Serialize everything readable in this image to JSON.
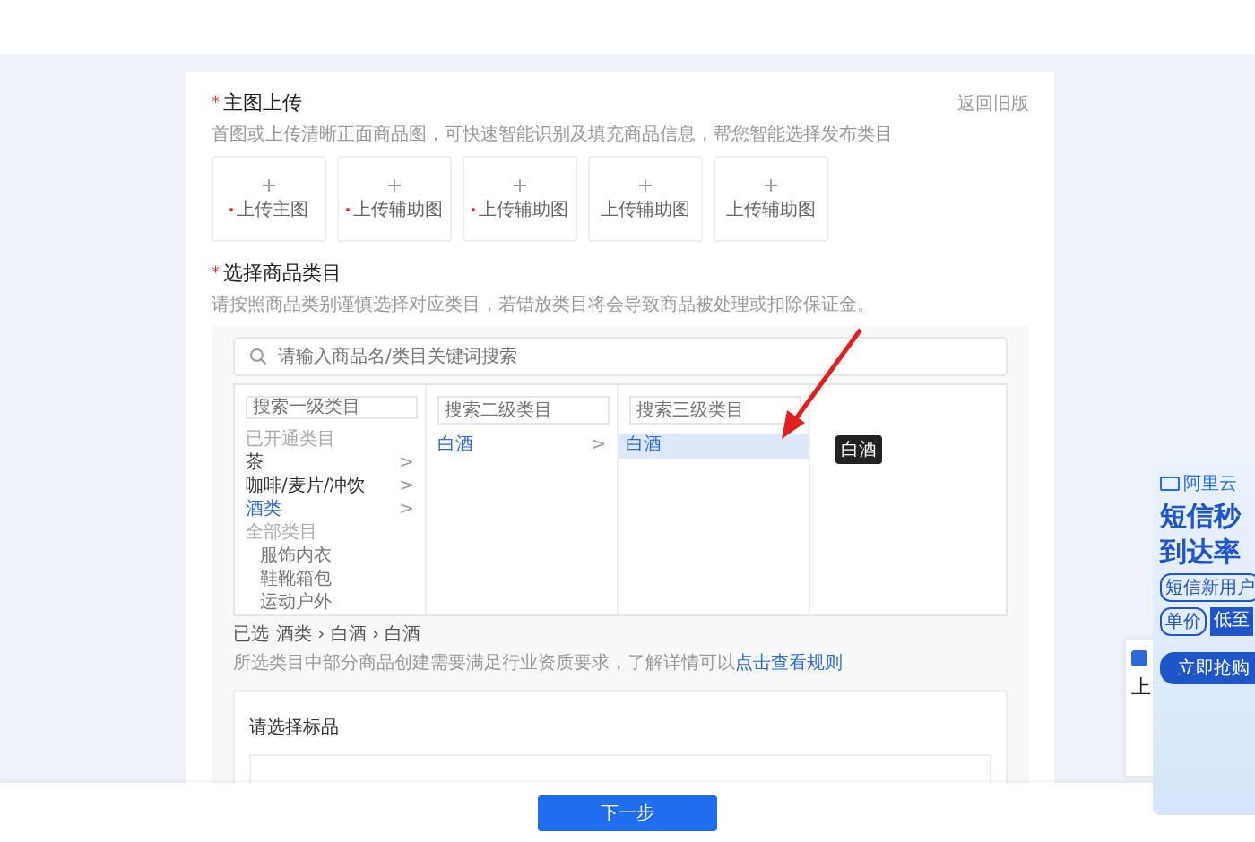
{
  "main_image": {
    "required_mark": "*",
    "title": "主图上传",
    "hint": "首图或上传清晰正面商品图，可快速智能识别及填充商品信息，帮您智能选择发布类目",
    "back_link": "返回旧版",
    "tiles": [
      {
        "plus": "+",
        "label": "上传主图",
        "required": true
      },
      {
        "plus": "+",
        "label": "上传辅助图",
        "required": true
      },
      {
        "plus": "+",
        "label": "上传辅助图",
        "required": true
      },
      {
        "plus": "+",
        "label": "上传辅助图",
        "required": false
      },
      {
        "plus": "+",
        "label": "上传辅助图",
        "required": false
      }
    ]
  },
  "category": {
    "required_mark": "*",
    "title": "选择商品类目",
    "hint": "请按照商品类别谨慎选择对应类目，若错放类目将会导致商品被处理或扣除保证金。",
    "search": {
      "placeholder": "请输入商品名/类目关键词搜索"
    },
    "columns": [
      {
        "placeholder": "搜索一级类目",
        "items": [
          {
            "kind": "group",
            "label": "已开通类目"
          },
          {
            "kind": "item",
            "label": "茶",
            "arrow": ">",
            "selected": false
          },
          {
            "kind": "item",
            "label": "咖啡/麦片/冲饮",
            "arrow": ">",
            "selected": false
          },
          {
            "kind": "item",
            "label": "酒类",
            "arrow": ">",
            "selected": true
          },
          {
            "kind": "group",
            "label": "全部类目"
          },
          {
            "kind": "folded",
            "label": "服饰内衣"
          },
          {
            "kind": "folded",
            "label": "鞋靴箱包"
          },
          {
            "kind": "folded",
            "label": "运动户外"
          }
        ]
      },
      {
        "placeholder": "搜索二级类目",
        "items": [
          {
            "kind": "item",
            "label": "白酒",
            "arrow": ">",
            "selected": true
          }
        ]
      },
      {
        "placeholder": "搜索三级类目",
        "items": [
          {
            "kind": "leaf",
            "label": "白酒",
            "selected": true
          }
        ]
      }
    ],
    "tooltip": "白酒",
    "selected_prefix": "已选",
    "path": [
      "酒类",
      "白酒",
      "白酒"
    ],
    "path_separator": "›",
    "note": "所选类目中部分商品创建需要满足行业资质要求，了解详情可以",
    "note_link": "点击查看规则"
  },
  "standard_product": {
    "title": "请选择标品"
  },
  "next_button": "下一步",
  "ad": {
    "brand": "阿里云",
    "headline": [
      "短信秒",
      "到达率"
    ],
    "chip": "短信新用户",
    "price_label": "单价",
    "price": "低至",
    "cta": "立即抢购"
  },
  "side_card": {
    "title": "上"
  }
}
